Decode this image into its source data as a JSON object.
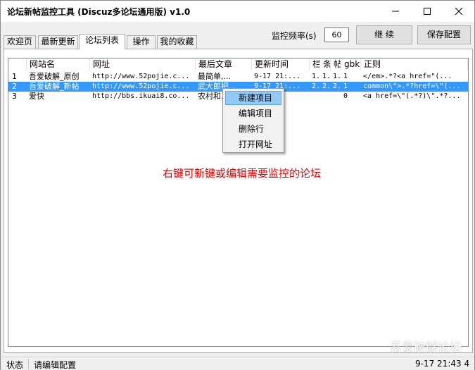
{
  "window": {
    "title": "论坛新帖监控工具 (Discuz多论坛通用版) v1.0"
  },
  "tabs": [
    {
      "label": "欢迎页"
    },
    {
      "label": "最新更新"
    },
    {
      "label": "论坛列表",
      "active": true
    },
    {
      "label": "操作"
    },
    {
      "label": "我的收藏"
    }
  ],
  "toolbar": {
    "freq_label": "监控频率(s)",
    "freq_value": "60",
    "continue_label": "继 续",
    "save_label": "保存配置"
  },
  "table": {
    "columns": [
      "",
      "网站名",
      "网址",
      "最后文章",
      "更新时间",
      "栏",
      "条",
      "帖",
      "gbk",
      "正则"
    ],
    "rows": [
      [
        "1",
        "吾爱破解_原创",
        "http://www.52pojie.c...",
        "最简单,...",
        "9-17 21:...",
        "1.",
        "1.",
        "1.",
        "1",
        "</em>.*?<a href=\"(..."
      ],
      [
        "2",
        "吾爱破解_新帖",
        "http://www.52pojie.c...",
        "武大郎把...",
        "9-17 21:...",
        "2.",
        "2.",
        "2.",
        "1",
        "common\\\">.*?href=\\\"(..."
      ],
      [
        "3",
        "爱快",
        "http://bbs.ikuai8.co...",
        "农村和...",
        "...",
        "",
        "",
        "",
        "0",
        "<a href=\\\"(.*?)\\\".*?..."
      ]
    ],
    "selected_row": 1
  },
  "context_menu": {
    "items": [
      "新建项目",
      "编辑项目",
      "删除行",
      "打开网址"
    ],
    "hovered": 0
  },
  "hint": "右键可新键或编辑需要监控的论坛",
  "status": {
    "label": "状态",
    "text": "请编辑配置",
    "time": "9-17 21:43 4"
  },
  "watermark": "吾爱破解论坛",
  "colors": {
    "selection": "#3399ff",
    "hint": "#e00000",
    "menu_hover": "#91c9f7"
  }
}
